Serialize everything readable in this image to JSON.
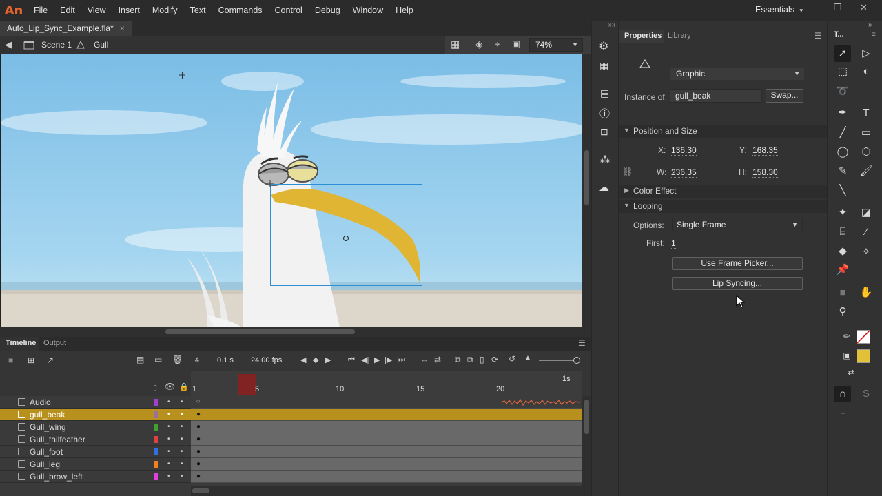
{
  "app": {
    "logo": "An",
    "menu": [
      "File",
      "Edit",
      "View",
      "Insert",
      "Modify",
      "Text",
      "Commands",
      "Control",
      "Debug",
      "Window",
      "Help"
    ],
    "workspace": "Essentials",
    "workspace_chevron": "▾"
  },
  "document": {
    "tab_title": "Auto_Lip_Sync_Example.fla*",
    "close_glyph": "×"
  },
  "editbar": {
    "scene": "Scene 1",
    "symbol": "Gull",
    "zoom": "74%"
  },
  "timeline": {
    "tabs": [
      "Timeline",
      "Output"
    ],
    "current_frame": "4",
    "elapsed": "0.1 s",
    "fps": "24.00 fps",
    "ruler_marks": [
      "1",
      "5",
      "10",
      "15",
      "20"
    ],
    "ruler_seconds": "1s",
    "layers": [
      {
        "name": "Audio",
        "color": "#a040d0"
      },
      {
        "name": "gull_beak",
        "color": "#9a70a0",
        "selected": true
      },
      {
        "name": "Gull_wing",
        "color": "#40a030"
      },
      {
        "name": "Gull_tailfeather",
        "color": "#e04040"
      },
      {
        "name": "Gull_foot",
        "color": "#3070e0"
      },
      {
        "name": "Gull_leg",
        "color": "#f08020"
      },
      {
        "name": "Gull_brow_left",
        "color": "#e040e0"
      }
    ]
  },
  "properties": {
    "tabs": [
      "Properties",
      "Library"
    ],
    "instance_type": "Graphic",
    "instance_of_label": "Instance of:",
    "instance_of_value": "gull_beak",
    "swap_label": "Swap...",
    "position_size_label": "Position and Size",
    "x_label": "X:",
    "x_value": "136.30",
    "y_label": "Y:",
    "y_value": "168.35",
    "w_label": "W:",
    "w_value": "236.35",
    "h_label": "H:",
    "h_value": "158.30",
    "color_effect_label": "Color Effect",
    "looping_label": "Looping",
    "options_label": "Options:",
    "options_value": "Single Frame",
    "first_label": "First:",
    "first_value": "1",
    "frame_picker_label": "Use Frame Picker...",
    "lip_sync_label": "Lip Syncing..."
  },
  "tools": {
    "panel_title": "T..."
  },
  "colors": {
    "accent_selected_layer": "#b8901e",
    "playhead": "#c01818",
    "selection_box": "#2d8fd6",
    "fill_swatch": "#e2c03a",
    "sky": "#8cc6e8",
    "beak": "#e0b534"
  }
}
